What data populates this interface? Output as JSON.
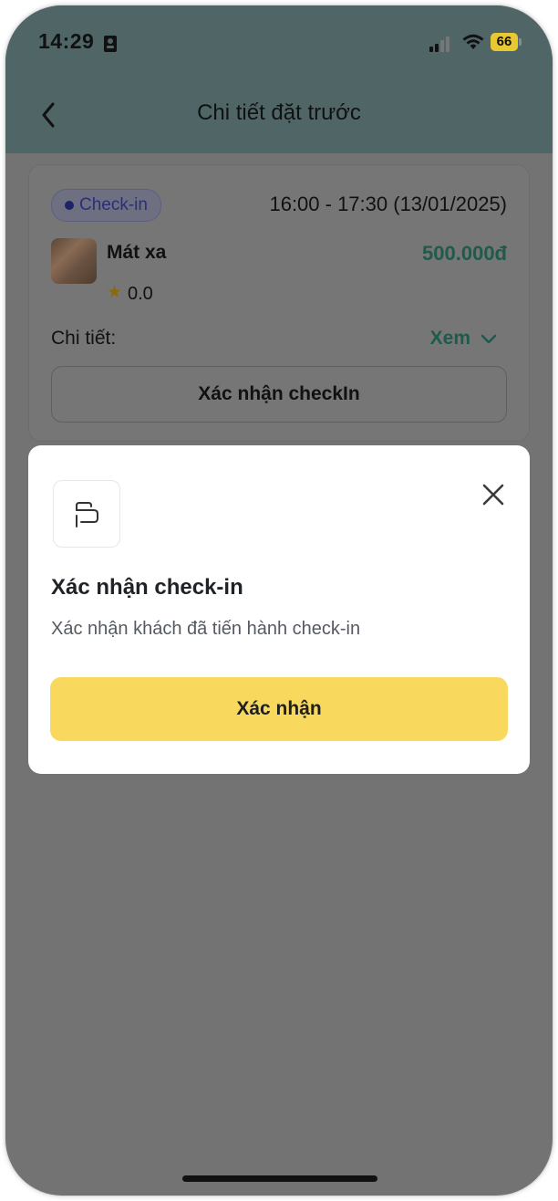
{
  "status_bar": {
    "time": "14:29",
    "battery": "66"
  },
  "header": {
    "title": "Chi tiết đặt trước"
  },
  "booking": {
    "status_badge": "Check-in",
    "time_range": "16:00 - 17:30 (13/01/2025)",
    "service_name": "Mát xa",
    "price": "500.000đ",
    "rating": "0.0",
    "details_label": "Chi tiết:",
    "view_label": "Xem",
    "confirm_checkin_label": "Xác nhận checkIn"
  },
  "modal": {
    "title": "Xác nhận check-in",
    "description": "Xác nhận khách đã tiến hành check-in",
    "confirm_label": "Xác nhận"
  },
  "colors": {
    "accent_yellow": "#f9d85e",
    "header_teal": "#4f6566",
    "price_green": "#1f5a4c",
    "badge_blue": "#2a2f78"
  }
}
